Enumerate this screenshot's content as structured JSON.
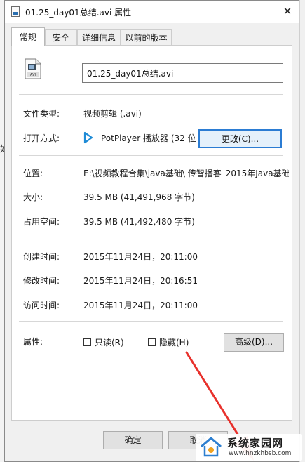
{
  "window": {
    "title": "01.25_day01总结.avi 属性",
    "close_glyph": "✕"
  },
  "tabs": [
    {
      "label": "常规",
      "active": true
    },
    {
      "label": "安全",
      "active": false
    },
    {
      "label": "详细信息",
      "active": false
    },
    {
      "label": "以前的版本",
      "active": false
    }
  ],
  "file": {
    "name": "01.25_day01总结.avi",
    "icon": "avi-video-file-icon"
  },
  "info": {
    "type_label": "文件类型:",
    "type_value": "视频剪辑 (.avi)",
    "openwith_label": "打开方式:",
    "openwith_value": "PotPlayer 播放器 (32 位)",
    "openwith_icon": "potplayer-icon",
    "change_button": "更改(C)...",
    "location_label": "位置:",
    "location_value": "E:\\视频教程合集\\java基础\\ 传智播客_2015年Java基础",
    "size_label": "大小:",
    "size_value": "39.5 MB (41,491,968 字节)",
    "disk_label": "占用空间:",
    "disk_value": "39.5 MB (41,492,480 字节)"
  },
  "times": {
    "created_label": "创建时间:",
    "created_value": "2015年11月24日，20:11:00",
    "modified_label": "修改时间:",
    "modified_value": "2015年11月24日，20:16:51",
    "accessed_label": "访问时间:",
    "accessed_value": "2015年11月24日，20:11:00"
  },
  "attributes": {
    "label": "属性:",
    "readonly_label": "只读(R)",
    "readonly_checked": false,
    "hidden_label": "隐藏(H)",
    "hidden_checked": false,
    "advanced_button": "高级(D)..."
  },
  "buttons": {
    "ok": "确定",
    "cancel": "取消"
  },
  "background": {
    "left_fragment": "好"
  },
  "annotation": {
    "arrow_color": "#e8312c"
  },
  "watermark": {
    "title": "系统家园网",
    "url": "www.hnzkhbsb.com"
  }
}
